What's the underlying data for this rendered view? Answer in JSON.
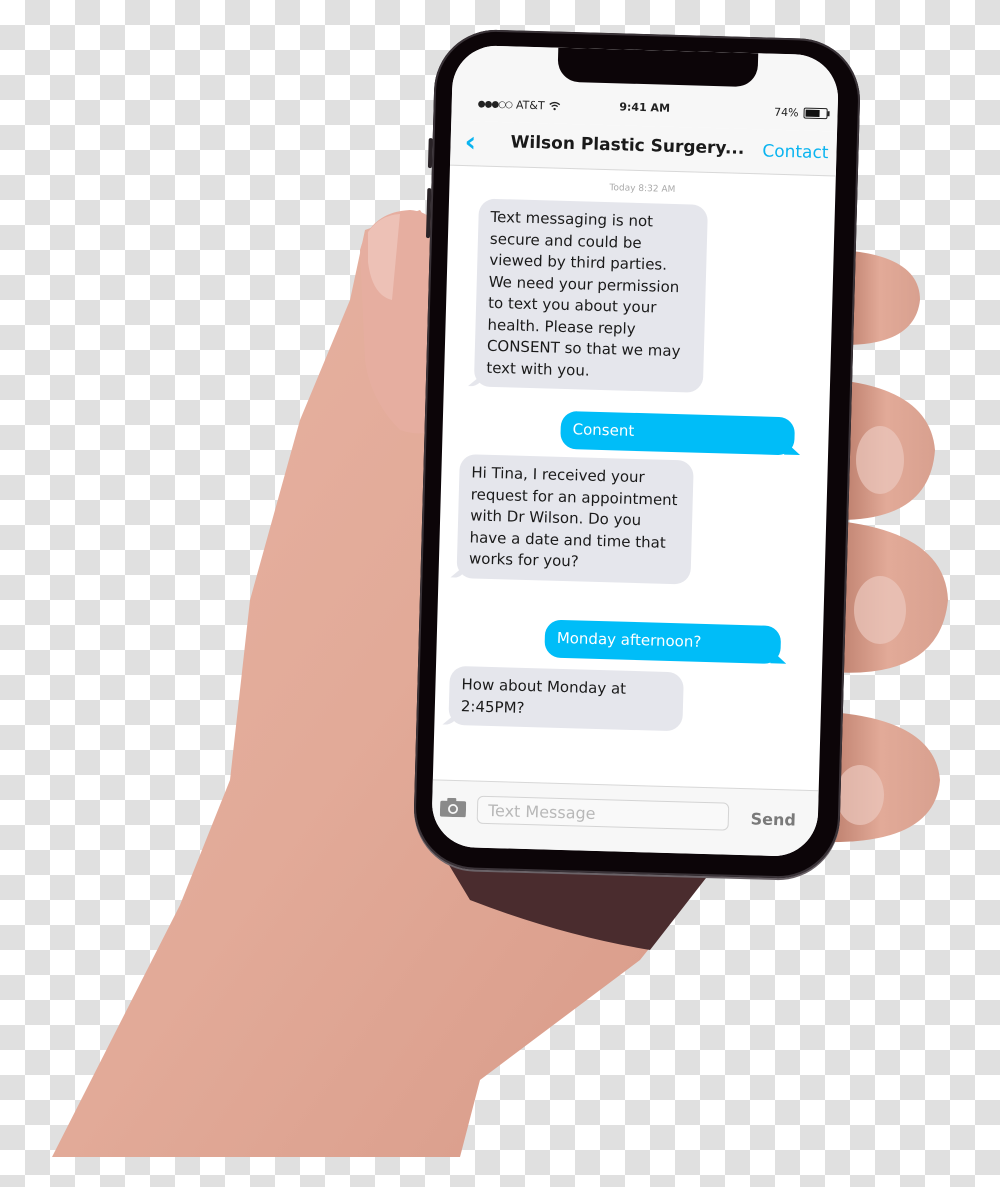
{
  "status_bar": {
    "signal_icon": "signal-dots-icon",
    "carrier": "AT&T",
    "wifi_icon": "wifi-icon",
    "time": "9:41 AM",
    "battery_percent": "74%",
    "battery_level": 0.74,
    "battery_icon": "battery-icon"
  },
  "header": {
    "back_icon": "chevron-left-icon",
    "title": "Wilson Plastic Surgery...",
    "action_label": "Contact"
  },
  "conversation": {
    "timestamp": "Today 8:32 AM",
    "messages": [
      {
        "direction": "incoming",
        "text": "Text messaging is not secure and could be viewed by third parties. We need your permission to text you about your health. Please reply CONSENT so that we may text with you."
      },
      {
        "direction": "outgoing",
        "text": "Consent"
      },
      {
        "direction": "incoming",
        "text": "Hi Tina, I received your request for an appointment with Dr Wilson. Do you have a date and time that works for you?"
      },
      {
        "direction": "outgoing",
        "text": "Monday afternoon?"
      },
      {
        "direction": "incoming",
        "text": "How about Monday at 2:45PM?"
      }
    ]
  },
  "composer": {
    "camera_icon": "camera-icon",
    "placeholder": "Text Message",
    "value": "",
    "send_label": "Send"
  },
  "colors": {
    "accent": "#0ab4f0",
    "outgoing_bubble": "#00bdf8",
    "incoming_bubble": "#e5e6ec",
    "phone_frame": "#0c0508",
    "skin": "#e6ad9c"
  }
}
